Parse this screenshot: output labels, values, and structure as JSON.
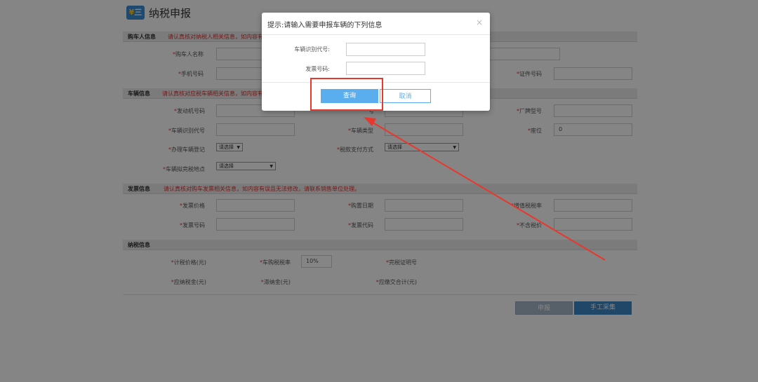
{
  "header": {
    "logo_glyph": "¥",
    "logo_glyph2": "三",
    "title": "纳税申报"
  },
  "sections": {
    "buyer": {
      "title": "购车人信息",
      "note": "请认真核对纳税人相关信息，如内容有"
    },
    "vehicle": {
      "title": "车辆信息",
      "note": "请认真核对应税车辆相关信息，如内容有"
    },
    "invoice": {
      "title": "发票信息",
      "note": "请认真核对购车发票相关信息，如内容有误且无法修改，请联系销售单位处理。"
    },
    "tax": {
      "title": "纳税信息"
    }
  },
  "required_mark": "*",
  "buyer_fields": {
    "name": "购车人名称",
    "phone": "手机号码",
    "cert_no": "证件号码"
  },
  "vehicle_fields": {
    "engine_no": "发动机号码",
    "vin": "车辆识别代号",
    "manufacturer_model": "厂牌型号",
    "vehicle_type": "车辆类型",
    "seats": "座位",
    "seats_value": "0",
    "register": "办理车辆登记",
    "payment_method": "税款支付方式",
    "tax_location": "车辆拟完税地点",
    "select_placeholder": "请选择",
    "partial_label": "号"
  },
  "invoice_fields": {
    "price": "发票价格",
    "purchase_date": "购置日期",
    "vat_rate": "增值税税率",
    "invoice_no": "发票号码",
    "invoice_code": "发票代码",
    "price_excl_tax": "不含税价"
  },
  "tax_fields": {
    "taxable_price": "计税价格(元)",
    "tax_rate": "车购税税率",
    "tax_rate_value": "10%",
    "exemption_cert": "完税证明号",
    "tax_payable": "应纳税金(元)",
    "late_fee": "滞纳金(元)",
    "total_payable": "应缴交合计(元)"
  },
  "actions": {
    "declare": "申报",
    "manual": "手工采集"
  },
  "dialog": {
    "title": "提示:请输入需要申报车辆的下列信息",
    "close": "×",
    "vin_label": "车辆识别代号:",
    "invoice_no_label": "发票号码:",
    "query": "查询",
    "cancel": "取消"
  },
  "colors": {
    "primary": "#5baeed",
    "annotation": "#e8382d",
    "required": "#e33333",
    "note": "#dd3333"
  }
}
